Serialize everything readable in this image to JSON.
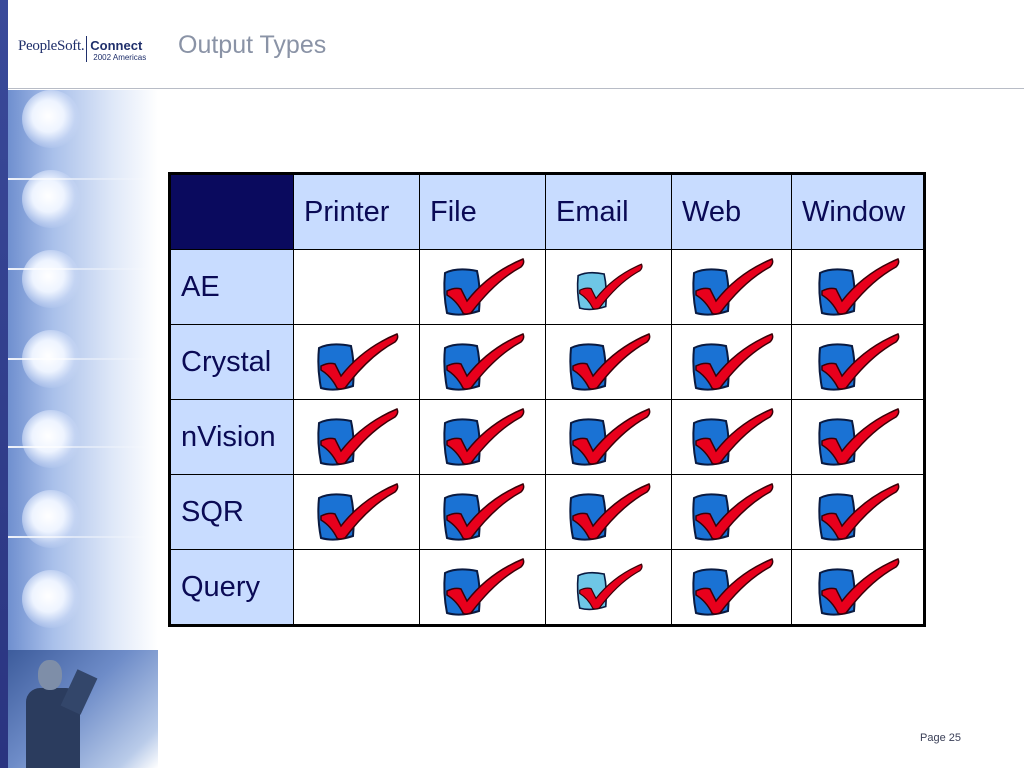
{
  "header": {
    "logo_brand": "PeopleSoft.",
    "logo_connect": "Connect",
    "logo_sub": "2002 Americas",
    "title": "Output Types"
  },
  "table": {
    "columns": [
      "Printer",
      "File",
      "Email",
      "Web",
      "Window"
    ],
    "rows": [
      {
        "label": "AE",
        "cells": [
          "none",
          "check",
          "check-light",
          "check",
          "check"
        ]
      },
      {
        "label": "Crystal",
        "cells": [
          "check",
          "check",
          "check",
          "check",
          "check"
        ]
      },
      {
        "label": "nVision",
        "cells": [
          "check",
          "check",
          "check",
          "check",
          "check"
        ]
      },
      {
        "label": "SQR",
        "cells": [
          "check",
          "check",
          "check",
          "check",
          "check"
        ]
      },
      {
        "label": "Query",
        "cells": [
          "none",
          "check",
          "check-light",
          "check",
          "check"
        ]
      }
    ]
  },
  "colors": {
    "header_bg": "#c8dcff",
    "corner_bg": "#0a0a5e",
    "check_box": "#1a72d4",
    "check_box_light": "#6ec6e6",
    "check_mark": "#e8001c"
  },
  "footer": {
    "page": "Page 25"
  }
}
